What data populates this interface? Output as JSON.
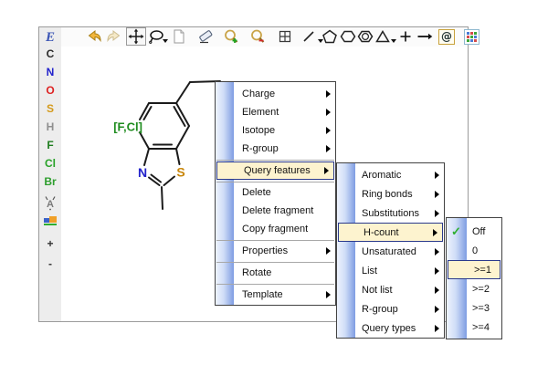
{
  "toolbar": {
    "icons": [
      "undo-icon",
      "redo-icon",
      "move-tool-icon",
      "lasso-tool-icon",
      "new-document-icon",
      "eraser-icon",
      "zoom-in-icon",
      "zoom-out-icon",
      "grid-icon",
      "bond-tool-icon",
      "pentagon-tool-icon",
      "hexagon-tool-icon",
      "benzene-tool-icon",
      "triangle-tool-icon",
      "plus-tool-icon",
      "reaction-arrow-icon",
      "at-symbol-icon",
      "color-table-icon"
    ],
    "at_glyph": "@"
  },
  "sidebar": {
    "edit_label": "E",
    "elements": [
      {
        "symbol": "C",
        "color": "#2b2b2b"
      },
      {
        "symbol": "N",
        "color": "#2222cc"
      },
      {
        "symbol": "O",
        "color": "#dd2222"
      },
      {
        "symbol": "S",
        "color": "#d49a1a"
      },
      {
        "symbol": "H",
        "color": "#8f8f8f"
      },
      {
        "symbol": "F",
        "color": "#1e7d1e"
      },
      {
        "symbol": "Cl",
        "color": "#28a228"
      },
      {
        "symbol": "Br",
        "color": "#2e9e2e"
      }
    ],
    "tools": [
      "any-atom-icon",
      "color-palette-icon"
    ],
    "zoom_plus_label": "+",
    "zoom_minus_label": "-"
  },
  "canvas": {
    "molecule": {
      "name_hint": "2-methyl-6-ethyl-benzothiazole with [F,Cl] atom list",
      "atoms": [
        {
          "label": "[F,Cl]",
          "color": "#1f8c1f"
        },
        {
          "label": "N",
          "color": "#2323cc"
        },
        {
          "label": "S",
          "color": "#c8860a"
        }
      ]
    }
  },
  "menus": {
    "context": {
      "items": [
        {
          "label": "Charge",
          "submenu": true
        },
        {
          "label": "Element",
          "submenu": true
        },
        {
          "label": "Isotope",
          "submenu": true
        },
        {
          "label": "R-group",
          "submenu": true
        },
        {
          "label": "Query features",
          "submenu": true,
          "highlighted": true
        },
        {
          "label": "Delete"
        },
        {
          "label": "Delete fragment"
        },
        {
          "label": "Copy fragment"
        },
        {
          "label": "Properties",
          "submenu": true
        },
        {
          "label": "Rotate"
        },
        {
          "label": "Template",
          "submenu": true
        }
      ]
    },
    "query_features": {
      "items": [
        {
          "label": "Aromatic",
          "submenu": true
        },
        {
          "label": "Ring bonds",
          "submenu": true
        },
        {
          "label": "Substitutions",
          "submenu": true
        },
        {
          "label": "H-count",
          "submenu": true,
          "highlighted": true
        },
        {
          "label": "Unsaturated",
          "submenu": true
        },
        {
          "label": "List",
          "submenu": true
        },
        {
          "label": "Not list",
          "submenu": true
        },
        {
          "label": "R-group",
          "submenu": true
        },
        {
          "label": "Query types",
          "submenu": true
        }
      ]
    },
    "h_count": {
      "check_glyph": "✓",
      "items": [
        {
          "label": "Off",
          "checked": true
        },
        {
          "label": "0"
        },
        {
          "label": ">=1",
          "highlighted": true
        },
        {
          "label": ">=2"
        },
        {
          "label": ">=3"
        },
        {
          "label": ">=4"
        }
      ]
    }
  },
  "colors": {
    "menu_highlight_bg": "#fdf3cf",
    "menu_highlight_border": "#2b3a8c",
    "menu_strip_light": "#eef3fd",
    "menu_strip_dark": "#7f9de3",
    "check_green": "#2eaf2e",
    "bond_black": "#1b1b1b"
  }
}
